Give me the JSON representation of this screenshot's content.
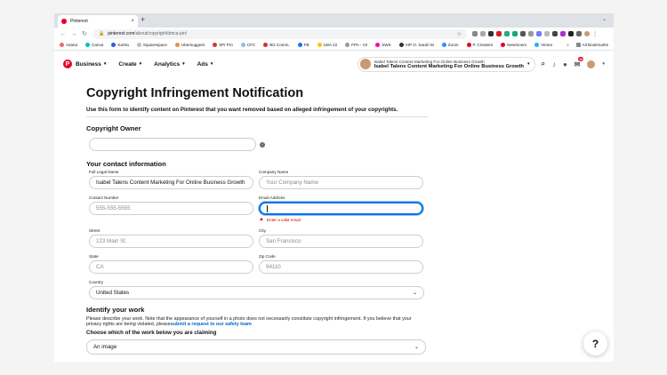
{
  "browser": {
    "tab_title": "Pinterest",
    "tab_close": "×",
    "new_tab": "+",
    "url_host": "pinterest.com",
    "url_path": "/about/copyright/dmca-pin/",
    "bookmarks": [
      "Asana",
      "Canva",
      "Kartra",
      "Squarespace",
      "Ubersuggest",
      "SPI Pro",
      "CFC",
      "Biz Comm.",
      "FB",
      "LWA 22",
      "FPA - V2",
      "SWK",
      "VIP O. Sarah M",
      "Zoom",
      "P. Creators",
      "Newsroom",
      "Vimeo"
    ],
    "bookmark_more": "»",
    "all_bookmarks": "All Bookmarks"
  },
  "header": {
    "nav": [
      "Business",
      "Create",
      "Analytics",
      "Ads"
    ],
    "account_line1": "Isabel Talens Content Marketing For Online Business Growth",
    "account_line2": "Isabel Talens Content Marketing For Online Business Growth",
    "notification_count": "10"
  },
  "form": {
    "title": "Copyright Infringement Notification",
    "subtitle": "Use this form to identify content on Pinterest that you want removed based on alleged infringement of your copyrights.",
    "owner_heading": "Copyright Owner",
    "owner_value": "",
    "contact_heading": "Your contact information",
    "fields": {
      "full_name": {
        "label": "Full Legal Name",
        "value": "Isabel Talens Content Marketing For Online Business Growth"
      },
      "company": {
        "label": "Company Name",
        "placeholder": "Your Company Name"
      },
      "contact_number": {
        "label": "Contact Number",
        "placeholder": "555-555-5555"
      },
      "email": {
        "label": "Email Address",
        "value": "",
        "error": "Enter a valid email"
      },
      "street": {
        "label": "Street",
        "placeholder": "123 Main St."
      },
      "city": {
        "label": "City",
        "placeholder": "San Francisco"
      },
      "state": {
        "label": "State",
        "placeholder": "CA"
      },
      "zip": {
        "label": "Zip Code",
        "placeholder": "94110"
      },
      "country": {
        "label": "Country",
        "value": "United States"
      }
    },
    "work_heading": "Identify your work",
    "work_desc": "Please describe your work. Note that the appearance of yourself in a photo does not necessarily constitute copyright infringement. If you believe that your privacy rights are being violated, please",
    "work_link": "submit a request to our safety team",
    "choose_label": "Choose which of the work below you are claiming",
    "work_select": "An image"
  },
  "help_button": "?"
}
